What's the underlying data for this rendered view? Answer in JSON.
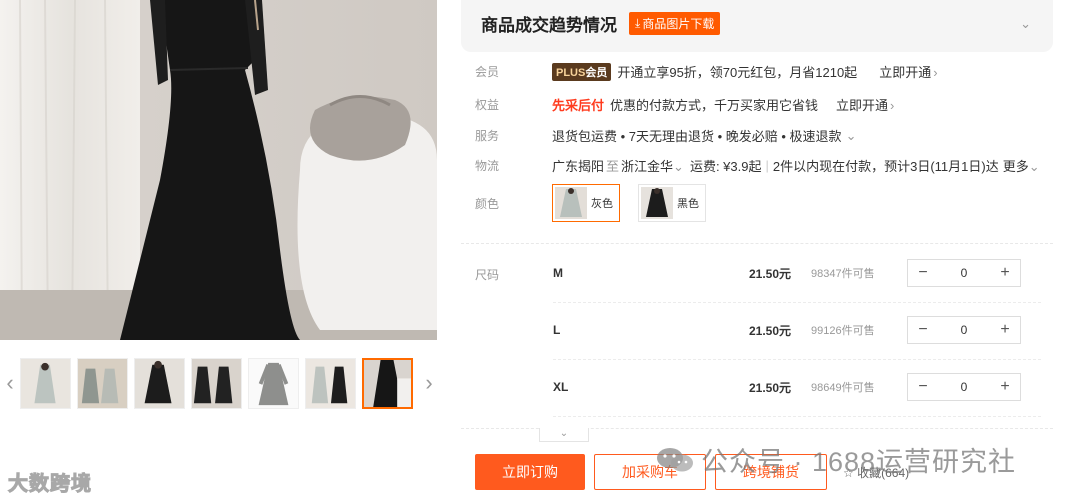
{
  "trend": {
    "title": "商品成交趋势情况",
    "download_label": "商品图片下载"
  },
  "member": {
    "label": "会员",
    "badge_plus": "PLUS",
    "badge_text": "会员",
    "text": "开通立享95折，领70元红包，月省1210起",
    "link": "立即开通"
  },
  "benefit": {
    "label": "权益",
    "tag": "先采后付",
    "text": "优惠的付款方式，千万买家用它省钱",
    "link": "立即开通"
  },
  "service": {
    "label": "服务",
    "text": "退货包运费 • 7天无理由退货 • 晚发必赔 • 极速退款"
  },
  "logistics": {
    "label": "物流",
    "from": "广东揭阳",
    "to_word": "至",
    "to": "浙江金华",
    "fee": "运费: ¥3.9起",
    "eta": "2件以内现在付款，预计3日(11月1日)达",
    "more": "更多"
  },
  "color": {
    "label": "颜色",
    "options": [
      {
        "name": "灰色",
        "selected": true
      },
      {
        "name": "黑色",
        "selected": false
      }
    ]
  },
  "size": {
    "label": "尺码",
    "rows": [
      {
        "name": "M",
        "price": "21.50元",
        "stock": "98347件可售",
        "qty": "0"
      },
      {
        "name": "L",
        "price": "21.50元",
        "stock": "99126件可售",
        "qty": "0"
      },
      {
        "name": "XL",
        "price": "21.50元",
        "stock": "98649件可售",
        "qty": "0"
      }
    ]
  },
  "actions": {
    "buy": "立即订购",
    "cart": "加采购车",
    "cross_border": "跨境铺货",
    "favorite": "收藏(664)"
  },
  "watermarks": {
    "left": "大数跨境",
    "right": "公众号 · 1688运营研究社"
  },
  "colors": {
    "accent": "#ff5a1e",
    "brand_orange": "#ff6a00"
  },
  "icons": [
    "download-icon",
    "chevron-down-icon",
    "chevron-right-icon",
    "chevron-left-icon",
    "minus-icon",
    "plus-icon",
    "star-icon",
    "wechat-icon"
  ]
}
